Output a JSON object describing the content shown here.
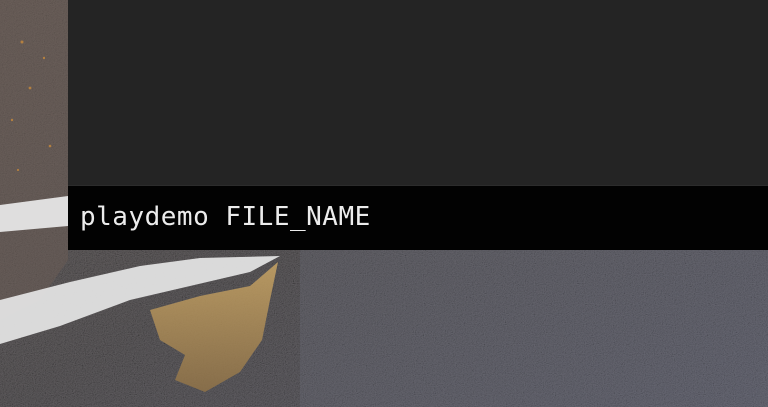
{
  "console": {
    "input_value": "playdemo FILE_NAME",
    "output_lines": []
  },
  "colors": {
    "console_output_bg": "#242424",
    "console_input_bg": "#020202",
    "console_text": "#ececec",
    "ground": "#5d5a58",
    "snow": "#e6e6e6",
    "sand": "#b7955a"
  }
}
